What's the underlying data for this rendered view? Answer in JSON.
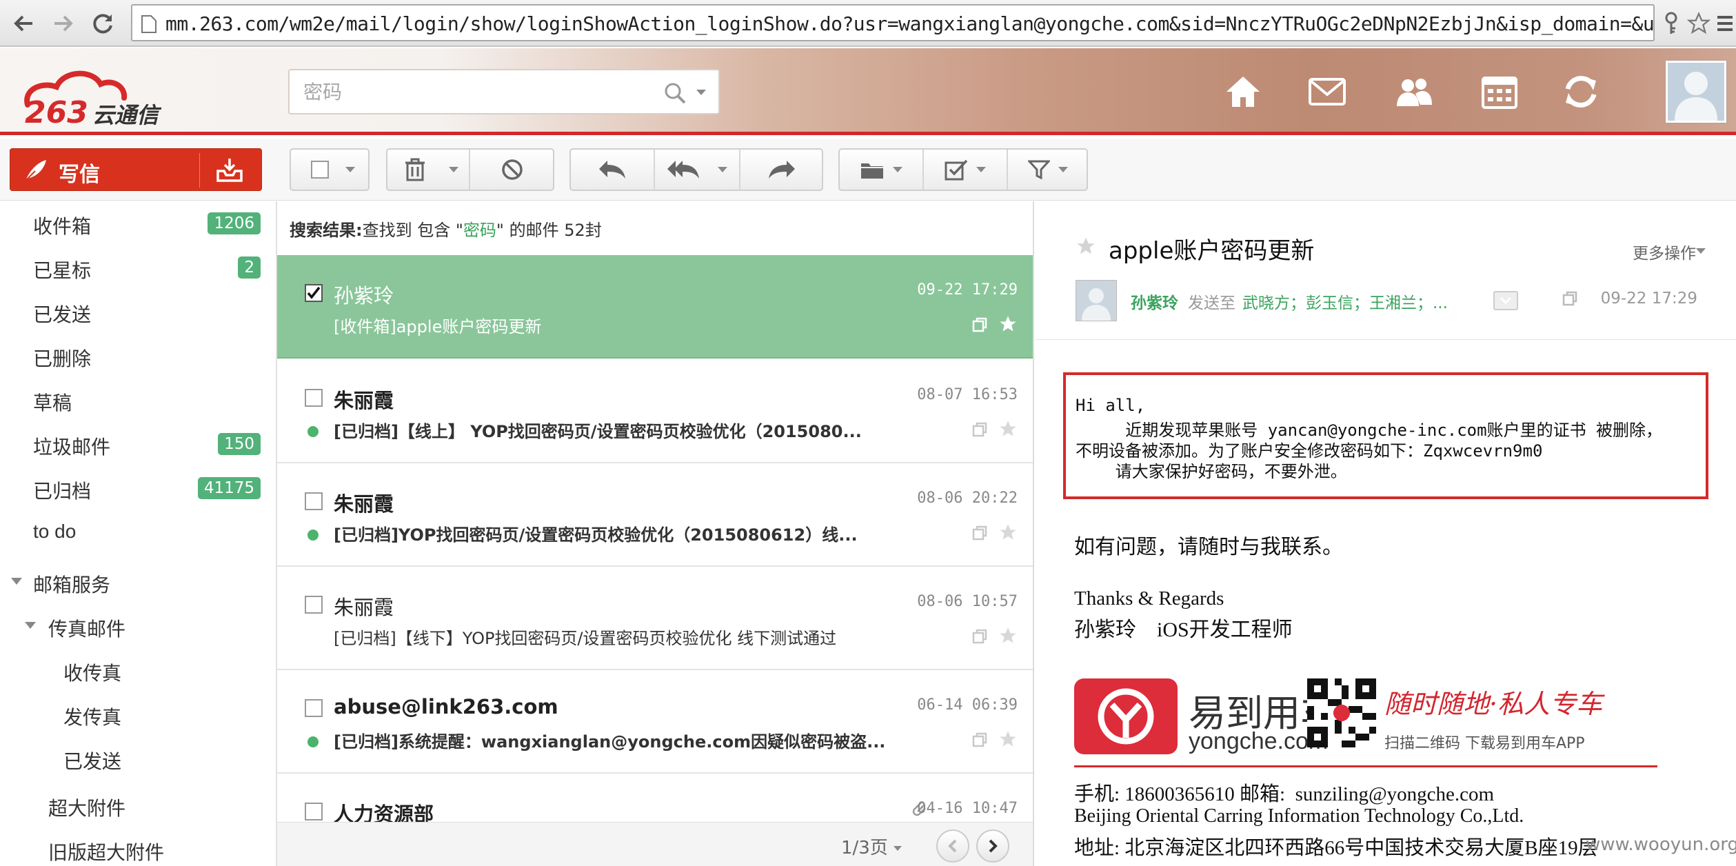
{
  "browser": {
    "url": "mm.263.com/wm2e/mail/login/show/loginShowAction_loginShow.do?usr=wangxianglan@yongche.com&sid=NnczYTRuOGc2eDNpN2EzbjJn&isp_domain=&use"
  },
  "header": {
    "logo_text": "263云通信",
    "search_placeholder": "密码",
    "icons": [
      "home-icon",
      "mail-icon",
      "contacts-icon",
      "calendar-icon",
      "refresh-icon"
    ]
  },
  "toolbar": {
    "compose_label": "写信",
    "buttons": [
      "checkbox",
      "delete",
      "block",
      "reply",
      "reply-all",
      "forward",
      "move-to-folder",
      "mark",
      "filter"
    ]
  },
  "sidebar": {
    "items": [
      {
        "label": "收件箱",
        "badge": "1206"
      },
      {
        "label": "已星标",
        "badge": "2"
      },
      {
        "label": "已发送",
        "badge": ""
      },
      {
        "label": "已删除",
        "badge": ""
      },
      {
        "label": "草稿",
        "badge": ""
      },
      {
        "label": "垃圾邮件",
        "badge": "150"
      },
      {
        "label": "已归档",
        "badge": "41175"
      },
      {
        "label": "to do",
        "badge": ""
      }
    ],
    "mailbox_services": "邮箱服务",
    "fax": "传真邮件",
    "fax_items": [
      "收传真",
      "发传真",
      "已发送"
    ],
    "large_attachment": "超大附件",
    "old_large_attachment": "旧版超大附件"
  },
  "list": {
    "search_result_label": "搜索结果:",
    "search_result_pre": "查找到 包含 \"",
    "search_result_keyword": "密码",
    "search_result_post": "\" 的邮件 52封",
    "rows": [
      {
        "sender": "孙紫玲",
        "time": "09-22 17:29",
        "subject": "[收件箱]apple账户密码更新",
        "selected": true,
        "unread": false
      },
      {
        "sender": "朱丽霞",
        "time": "08-07 16:53",
        "subject": "[已归档]【线上】 YOP找回密码页/设置密码页校验优化（2015080...",
        "selected": false,
        "unread": true
      },
      {
        "sender": "朱丽霞",
        "time": "08-06 20:22",
        "subject": "[已归档]YOP找回密码页/设置密码页校验优化（2015080612）线...",
        "selected": false,
        "unread": true
      },
      {
        "sender": "朱丽霞",
        "time": "08-06 10:57",
        "subject": "[已归档]【线下】YOP找回密码页/设置密码页校验优化 线下测试通过",
        "selected": false,
        "unread": false
      },
      {
        "sender": "abuse@link263.com",
        "time": "06-14 06:39",
        "subject": "[已归档]系统提醒：wangxianglan@yongche.com因疑似密码被盗...",
        "selected": false,
        "unread": true
      },
      {
        "sender": "人力资源部",
        "time": "04-16 10:47",
        "subject": "",
        "selected": false,
        "unread": true
      }
    ],
    "pager": "1/3页"
  },
  "reading": {
    "subject": "apple账户密码更新",
    "more_ops": "更多操作",
    "sender": "孙紫玲",
    "send_to_label": "发送至",
    "recipients": "武晓方；彭玉信；王湘兰；...",
    "time": "09-22 17:29",
    "body_lines": [
      "Hi all,",
      "     近期发现苹果账号 yancan@yongche-inc.com账户里的证书 被删除，",
      "不明设备被添加。为了账户安全修改密码如下：Zqxwcevrn9m0",
      "    请大家保护好密码，不要外泄。"
    ],
    "contact_line": "如有问题，请随时与我联系。",
    "thanks": "Thanks & Regards",
    "signature_name": "孙紫玲    iOS开发工程师",
    "brand_name": "易到用车",
    "brand_domain": "yongche.com",
    "slogan": "随时随地·私人专车",
    "slogan_sub": "扫描二维码   下载易到用车APP",
    "phone_line": "手机: 18600365610 邮箱:  sunziling@yongche.com",
    "company_line": "Beijing Oriental Carring Information Technology Co.,Ltd.",
    "address_line": "地址: 北京海淀区北四环西路66号中国技术交易大厦B座19层"
  },
  "watermark": "www.wooyun.org"
}
